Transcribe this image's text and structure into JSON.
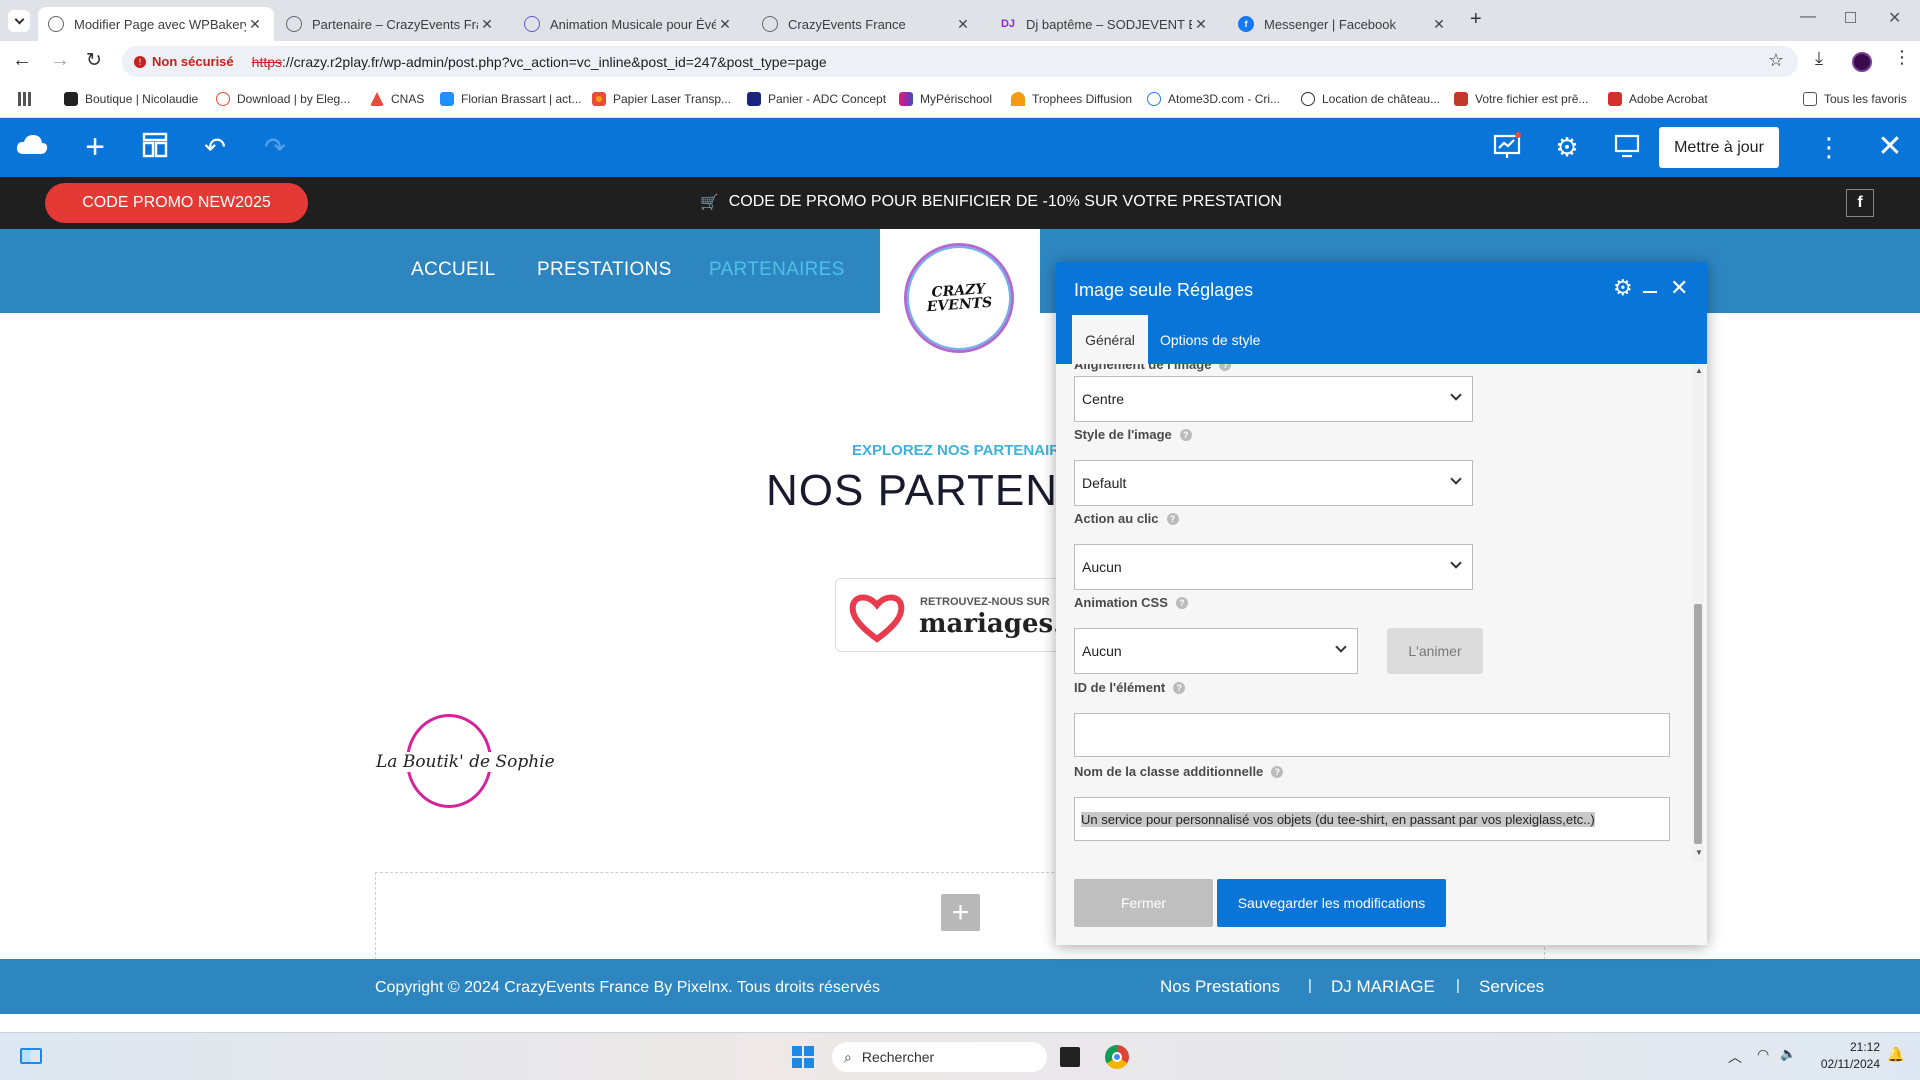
{
  "browser": {
    "tabs": [
      {
        "title": "Modifier Page avec WPBakery Page Builder"
      },
      {
        "title": "Partenaire – CrazyEvents France"
      },
      {
        "title": "Animation Musicale pour Événements"
      },
      {
        "title": "CrazyEvents France"
      },
      {
        "title": "Dj baptême – SODJEVENT Bailm"
      },
      {
        "title": "Messenger | Facebook"
      }
    ],
    "security": "Non sécurisé",
    "url_scheme": "https",
    "url_rest": "://crazy.r2play.fr/wp-admin/post.php?vc_action=vc_inline&post_id=247&post_type=page",
    "bookmarks": [
      "Boutique | Nicolaudie",
      "Download | by Eleg...",
      "CNAS",
      "Florian Brassart | act...",
      "Papier Laser Transp...",
      "Panier - ADC Concept",
      "MyPérischool",
      "Trophees Diffusion",
      "Atome3D.com - Cri...",
      "Location de château...",
      "Votre fichier est prê...",
      "Adobe Acrobat"
    ],
    "all_bookmarks": "Tous les favoris"
  },
  "wpbakery": {
    "update_label": "Mettre à jour"
  },
  "site": {
    "promo_code": "CODE PROMO NEW2025",
    "promo_text": "CODE DE PROMO POUR BENIFICIER DE -10% SUR VOTRE PRESTATION",
    "nav": [
      "ACCUEIL",
      "PRESTATIONS",
      "PARTENAIRES"
    ],
    "logo_text": "CRAZY EVENTS",
    "explore_label": "EXPLOREZ NOS PARTENAIRES",
    "heading": "NOS PARTENAIRES",
    "mariages_small": "RETROUVEZ-NOUS SUR",
    "mariages_big": "mariages.net",
    "boutik": "La Boutik' de Sophie",
    "footer_copyright": "Copyright © 2024 CrazyEvents France By Pixelnx. Tous droits réservés",
    "footer_links": [
      "Nos Prestations",
      "DJ MARIAGE",
      "Services"
    ]
  },
  "dialog": {
    "title": "Image seule Réglages",
    "tabs": [
      "Général",
      "Options de style"
    ],
    "partial_label": "Alignement de l'image",
    "alignment": {
      "value": "Centre"
    },
    "style": {
      "label": "Style de l'image",
      "value": "Default"
    },
    "click_action": {
      "label": "Action au clic",
      "value": "Aucun"
    },
    "css_animation": {
      "label": "Animation CSS",
      "value": "Aucun",
      "button": "L'animer"
    },
    "element_id": {
      "label": "ID de l'élément",
      "value": ""
    },
    "extra_class": {
      "label": "Nom de la classe additionnelle",
      "value": "Un service pour personnalisé vos objets (du tee-shirt, en passant par vos plexiglass,etc..)"
    },
    "close_button": "Fermer",
    "save_button": "Sauvegarder les modifications"
  },
  "taskbar": {
    "search_placeholder": "Rechercher",
    "time": "21:12",
    "date": "02/11/2024"
  }
}
